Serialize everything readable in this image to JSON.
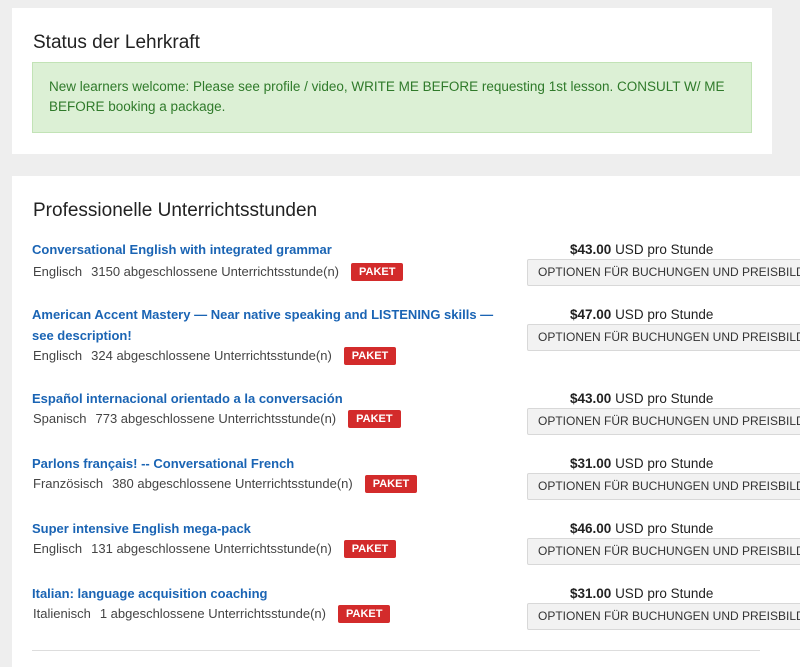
{
  "status": {
    "title": "Status der Lehrkraft",
    "notice": "New learners welcome: Please see profile / video, WRITE ME BEFORE requesting 1st lesson. CONSULT W/ ME BEFORE booking a package."
  },
  "lessons_section": {
    "title": "Professionelle Unterrichtsstunden",
    "paket_label": "PAKET",
    "options_label": "OPTIONEN FÜR BUCHUNGEN UND PREISBILDUNG",
    "price_unit": "USD pro Stunde",
    "items": [
      {
        "title": "Conversational English with integrated grammar",
        "language": "Englisch",
        "completed": "3150 abgeschlossene Unterrichtsstunde(n)",
        "price": "$43.00"
      },
      {
        "title": "American Accent Mastery — Near native speaking and LISTENING skills — see description!",
        "language": "Englisch",
        "completed": "324 abgeschlossene Unterrichtsstunde(n)",
        "price": "$47.00"
      },
      {
        "title": "Español internacional orientado a la conversación",
        "language": "Spanisch",
        "completed": "773 abgeschlossene Unterrichtsstunde(n)",
        "price": "$43.00"
      },
      {
        "title": "Parlons français! -- Conversational French",
        "language": "Französisch",
        "completed": "380 abgeschlossene Unterrichtsstunde(n)",
        "price": "$31.00"
      },
      {
        "title": "Super intensive English mega-pack",
        "language": "Englisch",
        "completed": "131 abgeschlossene Unterrichtsstunde(n)",
        "price": "$46.00"
      },
      {
        "title": "Italian: language acquisition coaching",
        "language": "Italienisch",
        "completed": "1 abgeschlossene Unterrichtsstunde(n)",
        "price": "$31.00"
      }
    ]
  },
  "colors": {
    "link": "#1a64b4",
    "paket": "#d32b2b",
    "notice_bg": "#dcf0d5",
    "notice_text": "#2f7a2a"
  }
}
